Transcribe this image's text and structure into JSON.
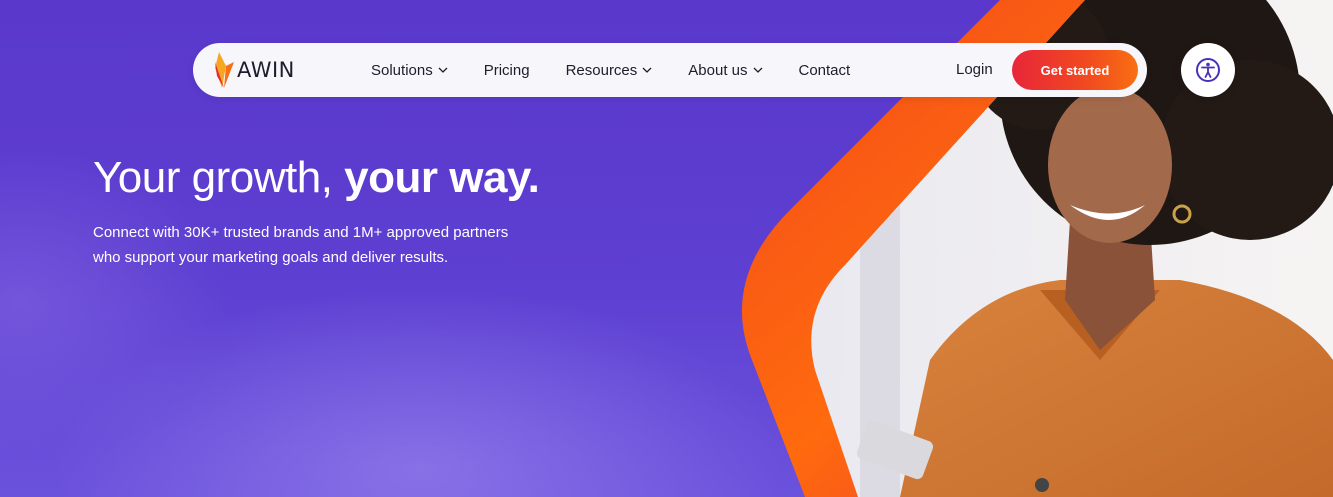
{
  "brand": {
    "name": "AWIN"
  },
  "nav": {
    "items": [
      {
        "label": "Solutions",
        "dropdown": true
      },
      {
        "label": "Pricing",
        "dropdown": false
      },
      {
        "label": "Resources",
        "dropdown": true
      },
      {
        "label": "About us",
        "dropdown": true
      },
      {
        "label": "Contact",
        "dropdown": false
      }
    ],
    "login_label": "Login",
    "cta_label": "Get started"
  },
  "accessibility": {
    "icon": "accessibility-icon"
  },
  "hero": {
    "title_regular": "Your growth, ",
    "title_bold": "your way.",
    "subtitle_line1": "Connect with 30K+ trusted brands and 1M+ approved partners",
    "subtitle_line2": "who support your marketing goals and deliver results."
  },
  "colors": {
    "background": "#5b3fcf",
    "accent_orange": "#f96f12",
    "accent_red": "#e8263a",
    "nav_bg": "#f7f7fb",
    "text_dark": "#1d1d2b",
    "a11y_icon": "#4a2fb8"
  }
}
